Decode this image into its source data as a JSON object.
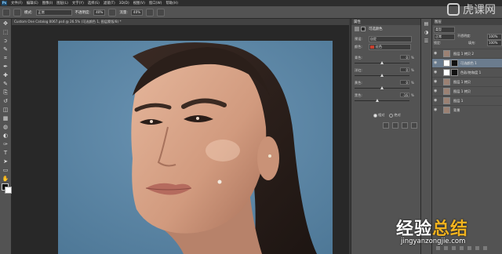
{
  "app": {
    "logo": "Ps"
  },
  "menu": [
    "文件(F)",
    "编辑(E)",
    "图像(I)",
    "图层(L)",
    "文字(Y)",
    "选择(S)",
    "滤镜(T)",
    "3D(D)",
    "视图(V)",
    "窗口(W)",
    "帮助(H)"
  ],
  "watermark_top": "虎课网",
  "options_bar": {
    "mode_label": "模式:",
    "mode_value": "正常",
    "opacity_label": "不透明度:",
    "opacity_value": "40%",
    "flow_label": "流量:",
    "flow_value": "40%"
  },
  "document": {
    "tab_title": "Custom One Catalog 0067.psd @ 26.5% (可选颜色 1, 图层蒙版/8) *"
  },
  "toolbar": {
    "icons": [
      "move-icon",
      "marquee-icon",
      "lasso-icon",
      "quick-select-icon",
      "crop-icon",
      "eyedropper-icon",
      "healing-icon",
      "brush-icon",
      "stamp-icon",
      "history-brush-icon",
      "eraser-icon",
      "gradient-icon",
      "blur-icon",
      "dodge-icon",
      "pen-icon",
      "type-icon",
      "path-select-icon",
      "shape-icon",
      "hand-icon",
      "zoom-icon"
    ],
    "glyphs": [
      "✥",
      "⬚",
      "ↄ",
      "✎",
      "⌗",
      "✒",
      "✚",
      "✎",
      "⎘",
      "↺",
      "◫",
      "▦",
      "◍",
      "◐",
      "✑",
      "T",
      "➤",
      "▭",
      "✋",
      "⌕"
    ]
  },
  "properties": {
    "header": "属性",
    "title": "可选颜色",
    "preset_label": "预设:",
    "preset_value": "自定",
    "colors_label": "颜色:",
    "colors_value": "红色",
    "rows": [
      {
        "name": "青色:",
        "value": "0",
        "slider": 0.5
      },
      {
        "name": "洋红:",
        "value": "0",
        "slider": 0.5
      },
      {
        "name": "黄色:",
        "value": "0",
        "slider": 0.5
      },
      {
        "name": "黑色:",
        "value": "-16",
        "slider": 0.42
      }
    ],
    "pct": "%",
    "method_relative": "相对",
    "method_absolute": "绝对",
    "method_selected": "relative"
  },
  "layers": {
    "tab": "图层",
    "kind_label": "类型",
    "blend_value": "正常",
    "opacity_label": "不透明度:",
    "opacity_value": "100%",
    "lock_label": "锁定:",
    "fill_label": "填充:",
    "fill_value": "100%",
    "items": [
      {
        "name": "图层 1 拷贝 2",
        "type": "pixel",
        "selected": false,
        "mask": false
      },
      {
        "name": "可选颜色 1",
        "type": "adjustment",
        "selected": true,
        "mask": true
      },
      {
        "name": "色彩/饱和度 1",
        "type": "adjustment",
        "selected": false,
        "mask": true
      },
      {
        "name": "图层 1 拷贝",
        "type": "pixel",
        "selected": false,
        "mask": false
      },
      {
        "name": "图层 1 拷贝",
        "type": "pixel",
        "selected": false,
        "mask": false
      },
      {
        "name": "图层 1",
        "type": "pixel",
        "selected": false,
        "mask": false
      },
      {
        "name": "背景",
        "type": "pixel",
        "selected": false,
        "mask": false
      }
    ]
  },
  "watermark_bottom": {
    "cn_white": "经验",
    "cn_gold": "总结",
    "en": "jingyanzongjie.com"
  },
  "colors": {
    "background_blue": "#5a86a8",
    "panel": "#535353",
    "dark": "#282828",
    "selected_layer": "#6b7c8e",
    "swatch_red": "#c8402f"
  }
}
